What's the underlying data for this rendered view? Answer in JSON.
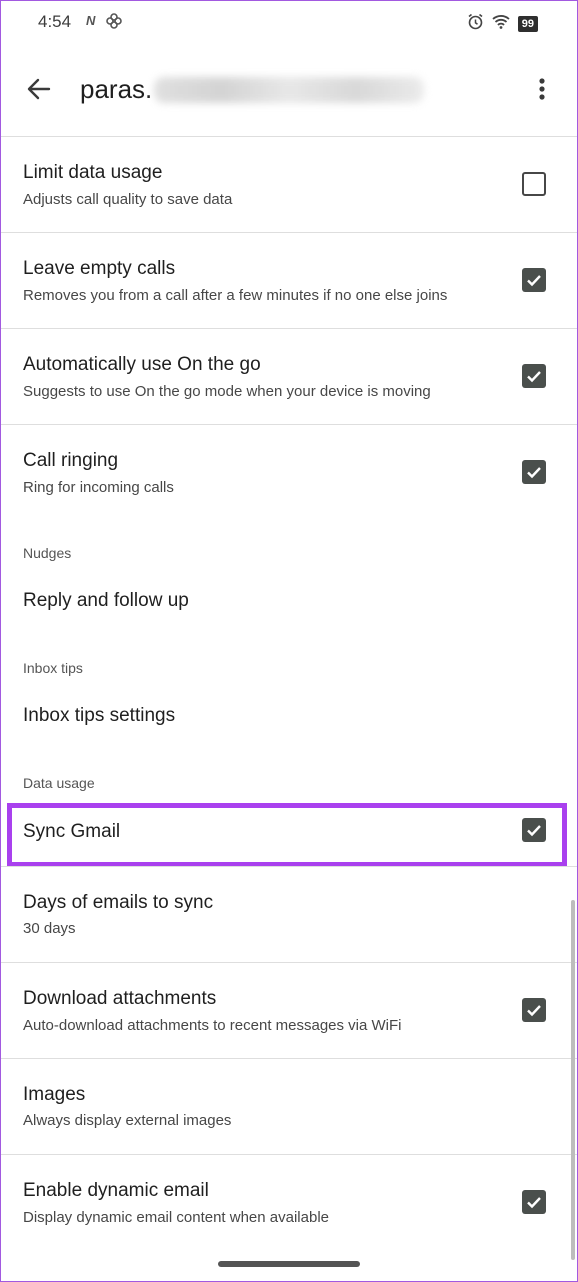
{
  "status_bar": {
    "time": "4:54",
    "notification_letter": "N",
    "battery": "99",
    "icons": [
      "alarm-icon",
      "wifi-icon",
      "battery-icon"
    ]
  },
  "app_bar": {
    "title_prefix": "paras.",
    "back_icon": "arrow-left-icon",
    "menu_icon": "more-vert-icon"
  },
  "settings": {
    "limit_data": {
      "title": "Limit data usage",
      "subtitle": "Adjusts call quality to save data",
      "checked": false
    },
    "leave_calls": {
      "title": "Leave empty calls",
      "subtitle": "Removes you from a call after a few minutes if no one else joins",
      "checked": true
    },
    "on_the_go": {
      "title": "Automatically use On the go",
      "subtitle": "Suggests to use On the go mode when your device is moving",
      "checked": true
    },
    "call_ringing": {
      "title": "Call ringing",
      "subtitle": "Ring for incoming calls",
      "checked": true
    },
    "nudges_header": "Nudges",
    "reply_follow": {
      "title": "Reply and follow up"
    },
    "inbox_tips_header": "Inbox tips",
    "inbox_tips_settings": {
      "title": "Inbox tips settings"
    },
    "data_usage_header": "Data usage",
    "sync_gmail": {
      "title": "Sync Gmail",
      "checked": true
    },
    "days_sync": {
      "title": "Days of emails to sync",
      "subtitle": "30 days"
    },
    "download_attachments": {
      "title": "Download attachments",
      "subtitle": "Auto-download attachments to recent messages via WiFi",
      "checked": true
    },
    "images": {
      "title": "Images",
      "subtitle": "Always display external images"
    },
    "dynamic_email": {
      "title": "Enable dynamic email",
      "subtitle": "Display dynamic email content when available",
      "checked": true
    }
  },
  "colors": {
    "highlight": "#a940ee",
    "checkbox_fill": "#4a4f4c"
  }
}
